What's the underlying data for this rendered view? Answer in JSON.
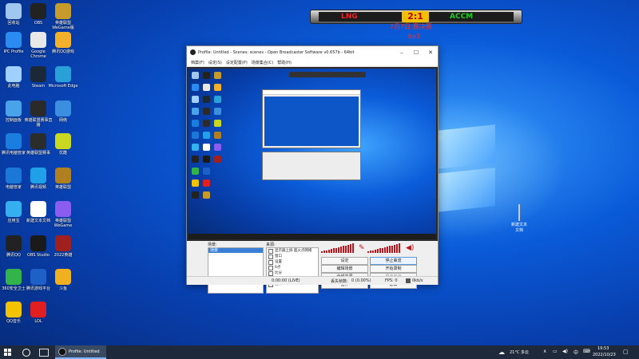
{
  "desktop_icons": [
    {
      "label": "回收站",
      "color": "#9fc7f0"
    },
    {
      "label": "OBS",
      "color": "#222222"
    },
    {
      "label": "英雄联盟 WeGame版",
      "color": "#c79a2c"
    },
    {
      "label": "IPC Profile",
      "color": "#2a8cf0"
    },
    {
      "label": "Google Chrome",
      "color": "#e8e8e8"
    },
    {
      "label": "腾讯QQ游戏",
      "color": "#f3b02a"
    },
    {
      "label": "此电脑",
      "color": "#9fd0ff"
    },
    {
      "label": "Steam",
      "color": "#1b2838"
    },
    {
      "label": "Microsoft Edge",
      "color": "#2aa0d8"
    },
    {
      "label": "控制面板",
      "color": "#4aa3e8"
    },
    {
      "label": "英雄联盟赛事直播",
      "color": "#2a2a2a"
    },
    {
      "label": "网络",
      "color": "#3c8fe0"
    },
    {
      "label": "腾讯电脑管家",
      "color": "#1a7ee0"
    },
    {
      "label": "英雄联盟赛事",
      "color": "#2c2c2c"
    },
    {
      "label": "优酷",
      "color": "#c8d820"
    },
    {
      "label": "电脑管家",
      "color": "#1c78d8"
    },
    {
      "label": "腾讯视频",
      "color": "#20a0e8"
    },
    {
      "label": "英雄联盟",
      "color": "#b08020"
    },
    {
      "label": "应用宝",
      "color": "#34b0f0"
    },
    {
      "label": "新建文本文档",
      "color": "#ffffff"
    },
    {
      "label": "英雄联盟WeGame",
      "color": "#8a5cf0"
    },
    {
      "label": "腾讯QQ",
      "color": "#222222"
    },
    {
      "label": "OBS Studio",
      "color": "#1a1a1a"
    },
    {
      "label": "2022英雄",
      "color": "#a02020"
    },
    {
      "label": "360安全卫士",
      "color": "#33b44a"
    },
    {
      "label": "腾讯游戏平台",
      "color": "#1e60c8"
    },
    {
      "label": "斗鱼",
      "color": "#f0b020"
    },
    {
      "label": "QQ音乐",
      "color": "#f4c300"
    },
    {
      "label": "LOL",
      "color": "#e02020"
    }
  ],
  "scoreboard": {
    "left_team": "LNG",
    "score": "2:1",
    "right_team": "ACCM",
    "subtitle1": "7月7日 赛决赛",
    "subtitle2": "bo3"
  },
  "obs": {
    "title": "Profile: Untitled - Scenes: scenes - Open Broadcaster Software v0.657b - 64bit",
    "menu": [
      "档案(F)",
      "设定(S)",
      "设定配置(P)",
      "场景集合(C)",
      "帮助(H)"
    ],
    "scenes_label": "场景:",
    "scenes": [
      "场景"
    ],
    "sources_label": "来源:",
    "sources": [
      "显示器上屏 超火点网络",
      "窗口",
      "设置",
      "6点",
      "比分",
      "图片2",
      "图片1"
    ],
    "buttons": {
      "settings": "设定",
      "stop_stream": "停止串流",
      "edit_scene": "编辑场景",
      "start_recording": "开始录制",
      "global_sources": "全域来源",
      "start_preview": "预览串流",
      "plugins": "插件",
      "exit": "退出"
    },
    "status": {
      "time": "0:00:00 (LIVE)",
      "dropped": "丢失帧数:",
      "dropped_val": "0 (0.00%)",
      "fps": "FPS: 0",
      "kbps": "0kb/s"
    }
  },
  "desktop_file": {
    "label": "新建文本文档"
  },
  "taskbar": {
    "app_label": "Profile: Untitled",
    "weather": "21°C 多云",
    "time": "19:53",
    "date": "2022/10/23"
  }
}
